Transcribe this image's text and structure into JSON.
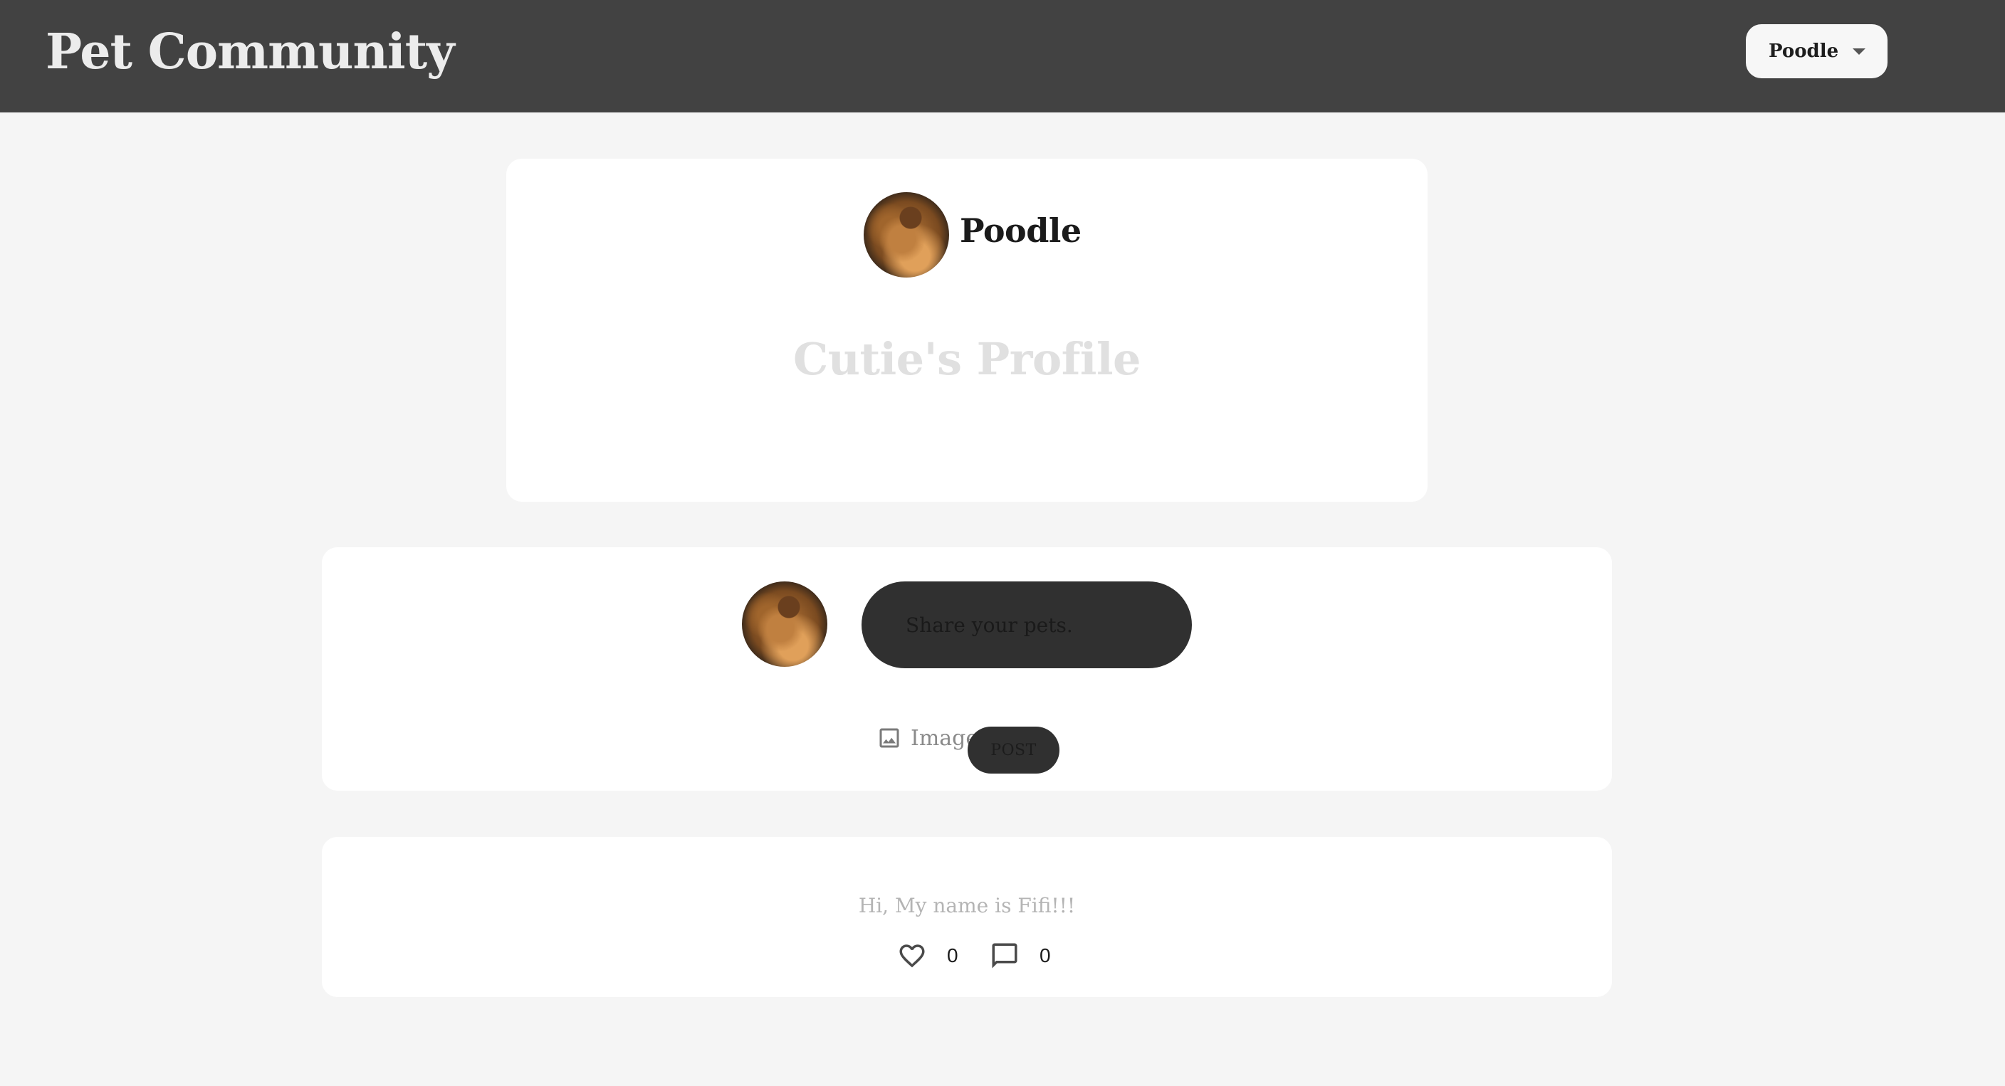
{
  "header": {
    "title": "Pet Community",
    "pet_selector": {
      "selected": "Poodle",
      "icon": "chevron-down-icon"
    }
  },
  "profile": {
    "name": "Poodle",
    "heading": "Cutie's Profile",
    "avatar": "poodle-avatar"
  },
  "composer": {
    "placeholder": "Share your pets.",
    "image_label": "Image",
    "post_label": "POST"
  },
  "posts": [
    {
      "text": "Hi, My name is Fifi!!!",
      "likes": "0",
      "comments": "0"
    }
  ],
  "colors": {
    "topbar": "#424242",
    "page_background": "#f5f5f5",
    "dark_control": "#303030"
  }
}
